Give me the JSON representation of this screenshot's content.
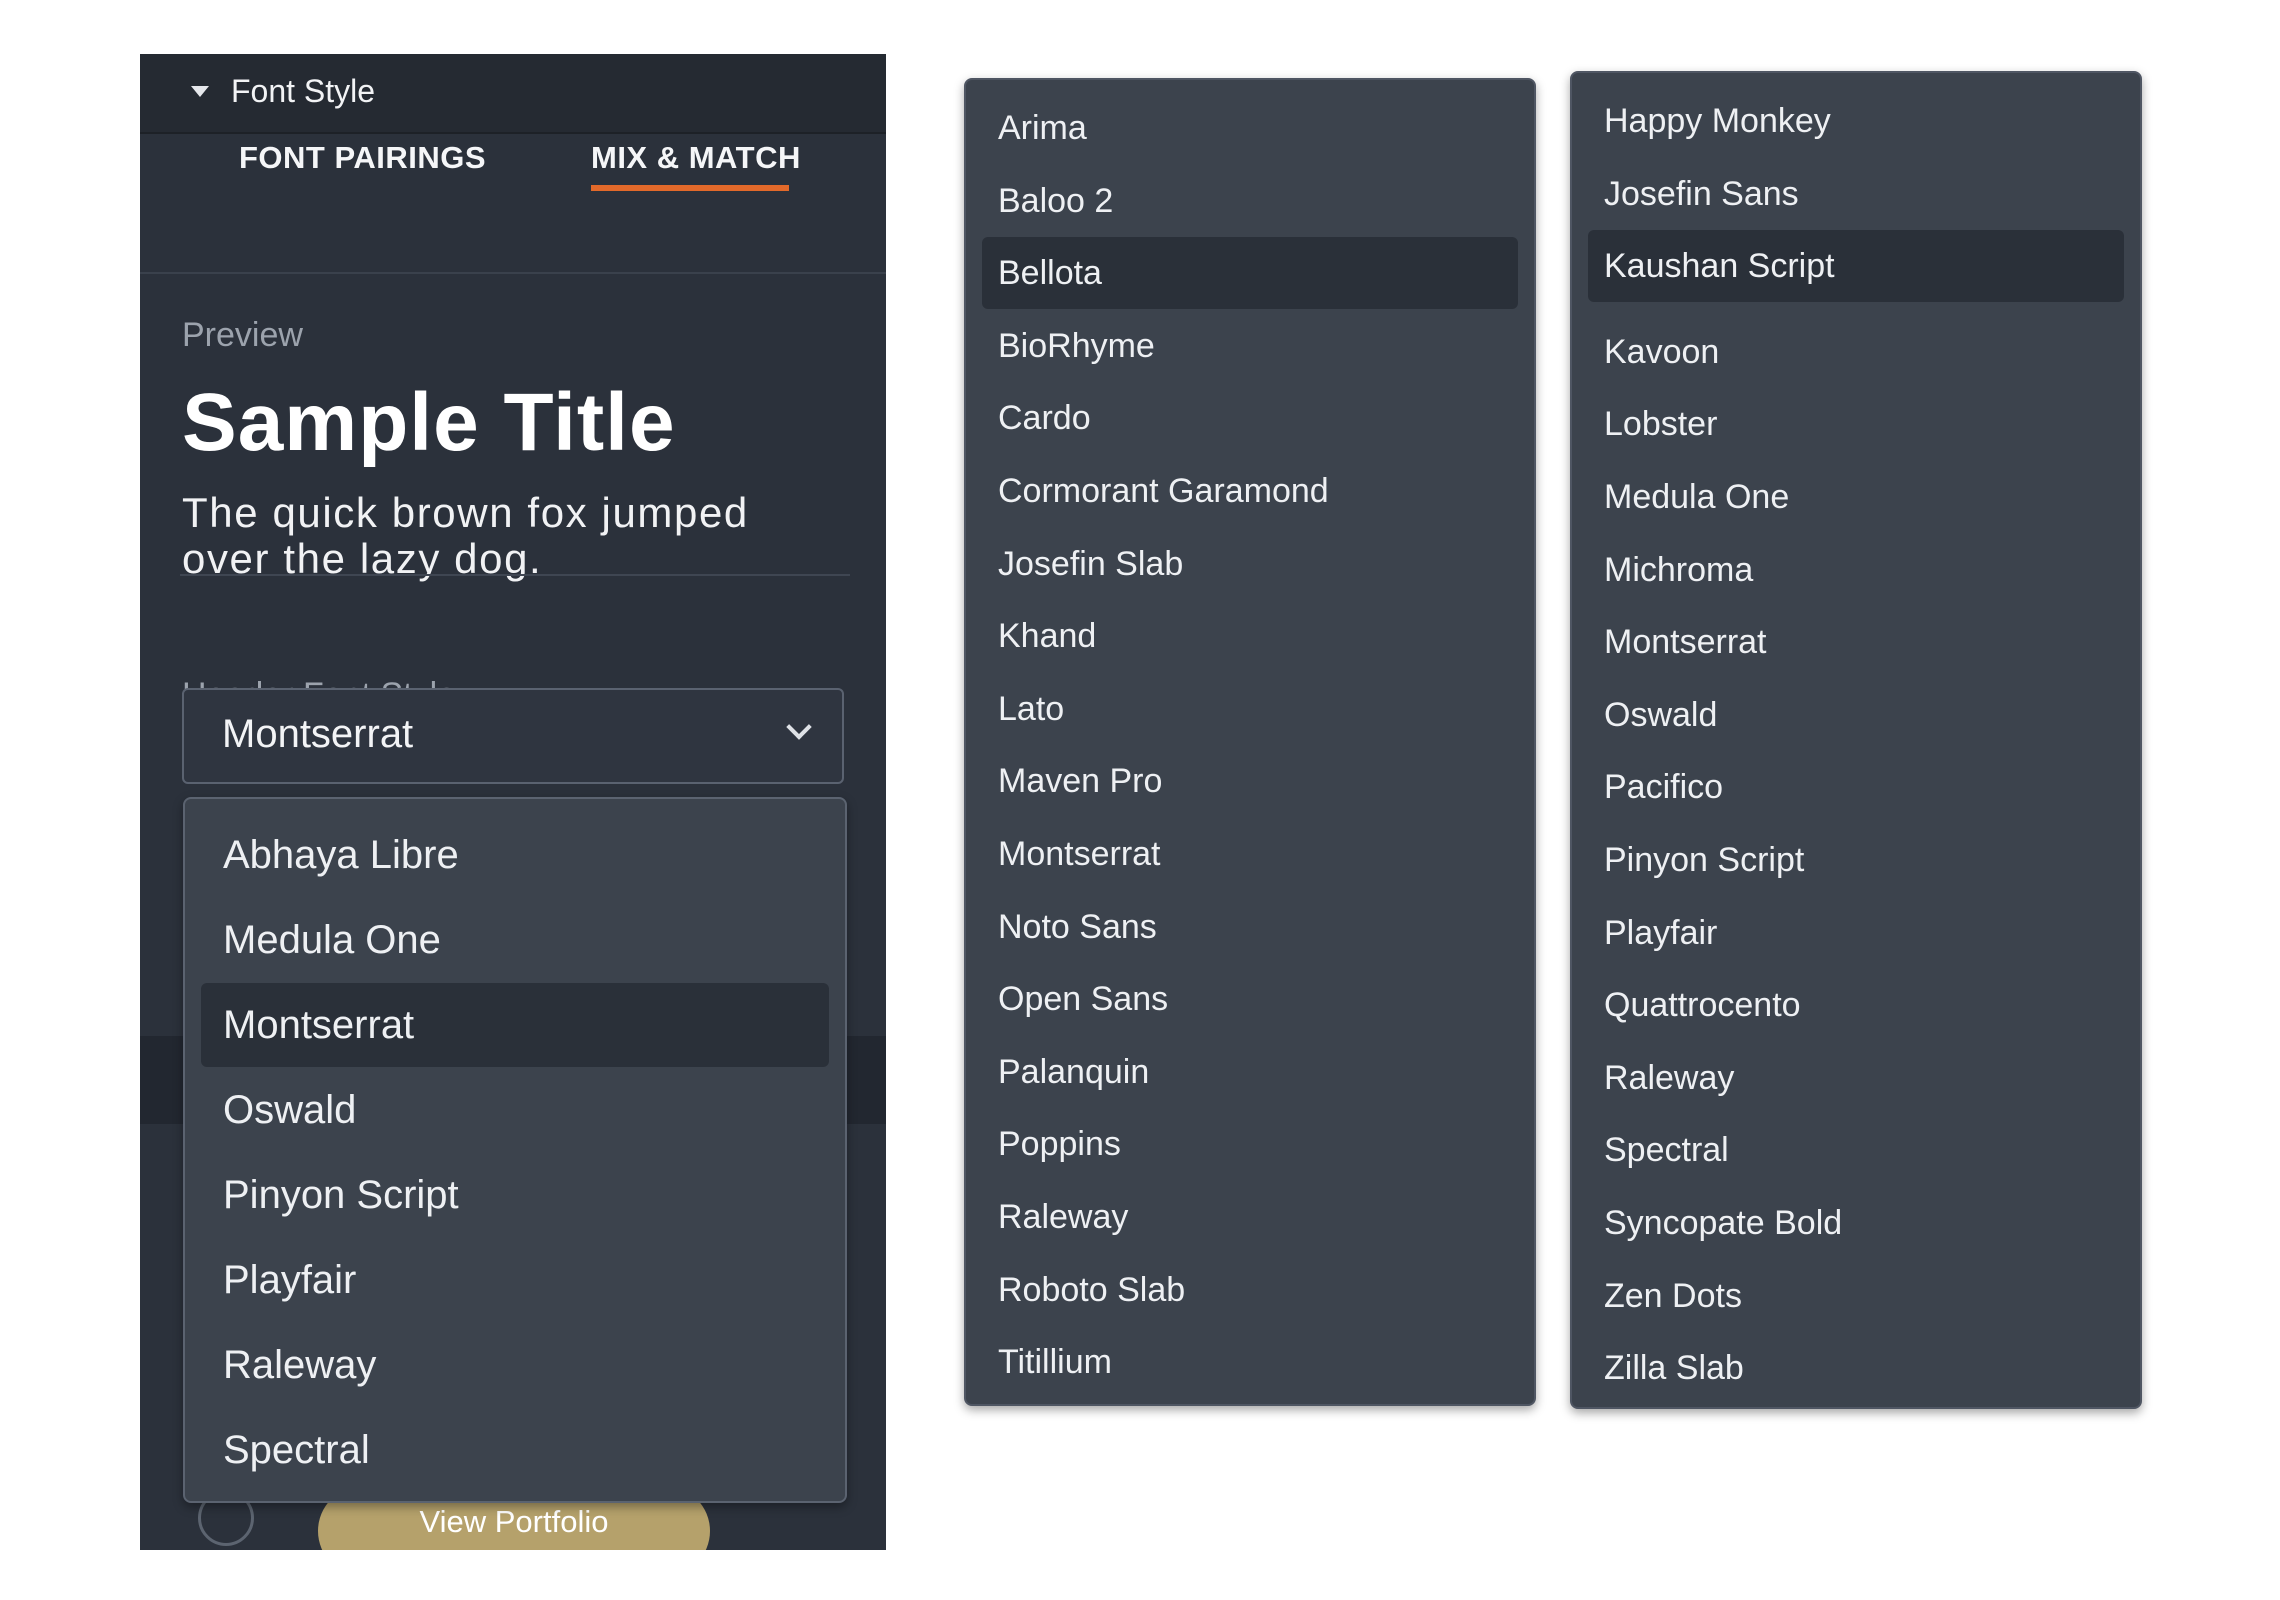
{
  "panel": {
    "title": "Font Style",
    "tabs": [
      {
        "label": "FONT PAIRINGS",
        "active": false
      },
      {
        "label": "MIX & MATCH",
        "active": true
      }
    ],
    "preview_label": "Preview",
    "sample_title": "Sample Title",
    "sample_body": "The quick brown fox jumped over the lazy dog.",
    "header_font_label": "Header Font Style",
    "selected_font": "Montserrat",
    "portfolio_button": "View Portfolio"
  },
  "colors": {
    "panel_bg": "#2b313b",
    "accent_underline": "#e2692a",
    "button_bg": "#b5a16b",
    "dropdown_bg": "#3c434d",
    "selected_item_bg": "#2a3039"
  },
  "dropdown_left": {
    "items": [
      "Abhaya Libre",
      "Medula One",
      "Montserrat",
      "Oswald",
      "Pinyon Script",
      "Playfair",
      "Raleway",
      "Spectral"
    ],
    "selected": "Montserrat"
  },
  "dropdown_middle": {
    "items": [
      "Arima",
      "Baloo 2",
      "Bellota",
      "BioRhyme",
      "Cardo",
      "Cormorant Garamond",
      "Josefin Slab",
      "Khand",
      "Lato",
      "Maven Pro",
      "Montserrat",
      "Noto Sans",
      "Open Sans",
      "Palanquin",
      "Poppins",
      "Raleway",
      "Roboto Slab",
      "Titillium"
    ],
    "selected": "Bellota"
  },
  "dropdown_right": {
    "items": [
      "Happy Monkey",
      "Josefin Sans",
      "Kaushan Script",
      "Kavoon",
      "Lobster",
      "Medula One",
      "Michroma",
      "Montserrat",
      "Oswald",
      "Pacifico",
      "Pinyon Script",
      "Playfair",
      "Quattrocento",
      "Raleway",
      "Spectral",
      "Syncopate Bold",
      "Zen Dots",
      "Zilla Slab"
    ],
    "selected": "Kaushan Script"
  }
}
